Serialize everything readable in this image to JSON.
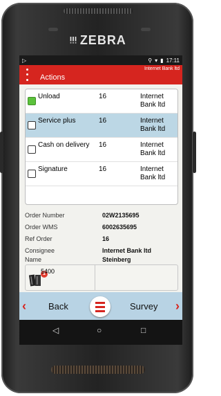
{
  "device": {
    "brand": "ZEBRA"
  },
  "statusbar": {
    "time": "17:11"
  },
  "appbar": {
    "title": "Actions",
    "subtitle": "Internet Bank ltd"
  },
  "actions": [
    {
      "name": "Unload",
      "qty": "16",
      "customer": "Internet Bank ltd",
      "checked": true
    },
    {
      "name": "Service plus",
      "qty": "16",
      "customer": "Internet Bank ltd",
      "checked": false
    },
    {
      "name": "Cash on delivery",
      "qty": "16",
      "customer": "Internet Bank ltd",
      "checked": false
    },
    {
      "name": "Signature",
      "qty": "16",
      "customer": "Internet Bank ltd",
      "checked": false
    }
  ],
  "details": [
    {
      "label": "Order Number",
      "value": "02W2135695"
    },
    {
      "label": "Order WMS",
      "value": "6002635695"
    },
    {
      "label": "Ref Order",
      "value": "16"
    },
    {
      "label": "Consignee",
      "value": "Internet Bank ltd"
    },
    {
      "label": "Name",
      "value": "Steinberg"
    }
  ],
  "bottombox": {
    "badge": "1",
    "value": "5400"
  },
  "navbar": {
    "back": "Back",
    "survey": "Survey",
    "prev_arrow": "‹",
    "next_arrow": "›"
  },
  "sysnav": {
    "back": "◁",
    "home": "○",
    "recents": "□"
  },
  "colors": {
    "accent": "#d6251f",
    "selected_row": "#bcd7e5",
    "check_on": "#5cc23c"
  }
}
